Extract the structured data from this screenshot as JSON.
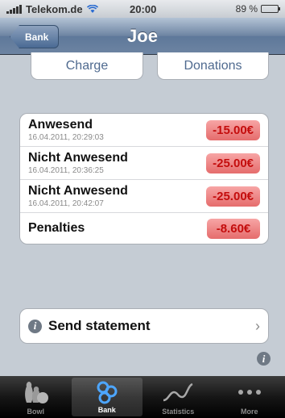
{
  "status": {
    "carrier": "Telekom.de",
    "time": "20:00",
    "battery": "89 %",
    "battery_level": 0.89
  },
  "nav": {
    "back_label": "Bank",
    "title": "Joe"
  },
  "segments": {
    "charge": "Charge",
    "donations": "Donations"
  },
  "entries": [
    {
      "name": "Anwesend",
      "date": "16.04.2011, 20:29:03",
      "amount": "-15.00€"
    },
    {
      "name": "Nicht Anwesend",
      "date": "16.04.2011, 20:36:25",
      "amount": "-25.00€"
    },
    {
      "name": "Nicht Anwesend",
      "date": "16.04.2011, 20:42:07",
      "amount": "-25.00€"
    }
  ],
  "penalties": {
    "name": "Penalties",
    "amount": "-8.60€"
  },
  "statement": {
    "label": "Send statement",
    "chevron": "›"
  },
  "tabs": [
    {
      "label": "Bowl",
      "icon": "bowling-icon"
    },
    {
      "label": "Bank",
      "icon": "coins-icon"
    },
    {
      "label": "Statistics",
      "icon": "graph-icon"
    },
    {
      "label": "More",
      "icon": "more-icon"
    }
  ],
  "colors": {
    "navbar": "#6d84a2",
    "amount_bg": "#e56c6c",
    "amount_text": "#c40d0d",
    "background": "#c5ccd4"
  }
}
